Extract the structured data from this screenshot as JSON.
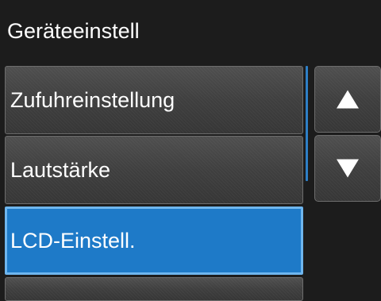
{
  "header": {
    "title": "Geräteeinstell"
  },
  "menu": {
    "items": [
      {
        "label": "Zufuhreinstellung",
        "selected": false
      },
      {
        "label": "Lautstärke",
        "selected": false
      },
      {
        "label": "LCD-Einstell.",
        "selected": true
      },
      {
        "label": "",
        "selected": false
      }
    ]
  },
  "scrollbar": {
    "up_icon": "triangle-up-icon",
    "down_icon": "triangle-down-icon"
  },
  "colors": {
    "background": "#1c1c1c",
    "selected_fill": "#1e7ac8",
    "selected_border": "#6fb6ee",
    "scroll_thumb": "#2e7fc6",
    "text": "#ffffff"
  }
}
